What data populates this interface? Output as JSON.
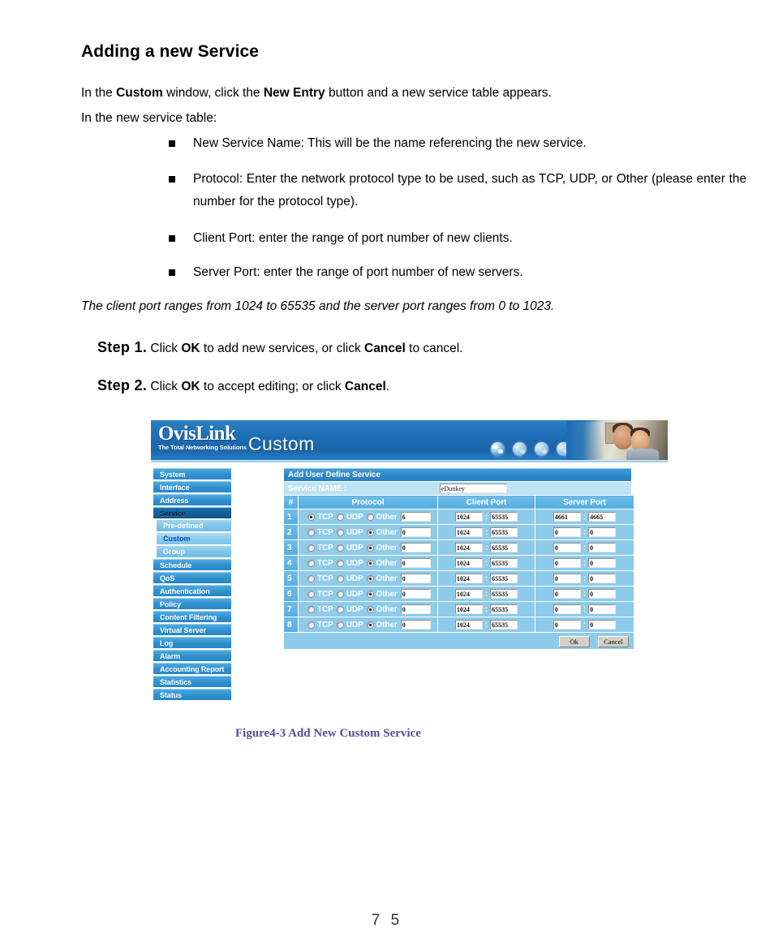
{
  "document": {
    "heading": "Adding a new Service",
    "intro_line_1_parts": [
      "In the ",
      "Custom",
      " window, click the ",
      "New Entry",
      " button and a new service table appears."
    ],
    "intro_line_2": "In the new service table:",
    "bullets": [
      "New Service Name: This will be the name referencing the new service.",
      "Protocol: Enter the network protocol type to be used, such as TCP, UDP, or Other (please enter the number for the protocol type).",
      "Client Port: enter the range of port number of new clients.",
      "Server Port: enter the range of port number of new servers."
    ],
    "note": "The client port ranges from 1024 to 65535 and the server port ranges from 0 to 1023.",
    "steps": [
      {
        "number": "Step 1.",
        "parts": [
          " Click ",
          "OK",
          " to add new services, or click ",
          "Cancel",
          " to cancel."
        ]
      },
      {
        "number": "Step 2.",
        "parts": [
          " Click ",
          "OK",
          " to accept editing; or click ",
          "Cancel",
          "."
        ]
      }
    ],
    "figure_caption": "Figure4-3 Add New Custom Service",
    "page_number": "7 5"
  },
  "screenshot": {
    "brand": {
      "name": "OvisLink",
      "tagline": "The Total Networking Solutions"
    },
    "title": "Custom",
    "sidebar": {
      "items": [
        {
          "label": "System",
          "type": "item",
          "state": "normal"
        },
        {
          "label": "Interface",
          "type": "item",
          "state": "normal"
        },
        {
          "label": "Address",
          "type": "item",
          "state": "normal"
        },
        {
          "label": "Service",
          "type": "item",
          "state": "active"
        },
        {
          "label": "Pre-defined",
          "type": "sub",
          "state": "normal"
        },
        {
          "label": "Custom",
          "type": "sub",
          "state": "selected"
        },
        {
          "label": "Group",
          "type": "sub",
          "state": "normal"
        },
        {
          "label": "Schedule",
          "type": "item",
          "state": "normal"
        },
        {
          "label": "QoS",
          "type": "item",
          "state": "normal"
        },
        {
          "label": "Authentication",
          "type": "item",
          "state": "normal"
        },
        {
          "label": "Policy",
          "type": "item",
          "state": "normal"
        },
        {
          "label": "Content Filtering",
          "type": "item",
          "state": "normal"
        },
        {
          "label": "Virtual Server",
          "type": "item",
          "state": "normal"
        },
        {
          "label": "Log",
          "type": "item",
          "state": "normal"
        },
        {
          "label": "Alarm",
          "type": "item",
          "state": "normal"
        },
        {
          "label": "Accounting Report",
          "type": "item",
          "state": "normal"
        },
        {
          "label": "Statistics",
          "type": "item",
          "state": "normal"
        },
        {
          "label": "Status",
          "type": "item",
          "state": "normal"
        }
      ]
    },
    "panel": {
      "title": "Add User Define Service",
      "service_name_label": "Service NAME :",
      "service_name_value": "eDonkey",
      "columns": [
        "#",
        "Protocol",
        "Client Port",
        "Server Port"
      ],
      "protocol_options": [
        "TCP",
        "UDP",
        "Other"
      ],
      "rows": [
        {
          "num": "1",
          "selected": "TCP",
          "other": "6",
          "client_from": "1024",
          "client_to": "65535",
          "server_from": "4661",
          "server_to": "4665"
        },
        {
          "num": "2",
          "selected": "Other",
          "other": "0",
          "client_from": "1024",
          "client_to": "65535",
          "server_from": "0",
          "server_to": "0"
        },
        {
          "num": "3",
          "selected": "Other",
          "other": "0",
          "client_from": "1024",
          "client_to": "65535",
          "server_from": "0",
          "server_to": "0"
        },
        {
          "num": "4",
          "selected": "Other",
          "other": "0",
          "client_from": "1024",
          "client_to": "65535",
          "server_from": "0",
          "server_to": "0"
        },
        {
          "num": "5",
          "selected": "Other",
          "other": "0",
          "client_from": "1024",
          "client_to": "65535",
          "server_from": "0",
          "server_to": "0"
        },
        {
          "num": "6",
          "selected": "Other",
          "other": "0",
          "client_from": "1024",
          "client_to": "65535",
          "server_from": "0",
          "server_to": "0"
        },
        {
          "num": "7",
          "selected": "Other",
          "other": "0",
          "client_from": "1024",
          "client_to": "65535",
          "server_from": "0",
          "server_to": "0"
        },
        {
          "num": "8",
          "selected": "Other",
          "other": "0",
          "client_from": "1024",
          "client_to": "65535",
          "server_from": "0",
          "server_to": "0"
        }
      ],
      "separator": ":",
      "ok_label": "Ok",
      "cancel_label": "Cancel"
    },
    "colors": {
      "header_blue": "#1d6cb4",
      "nav_blue": "#2e8fcd",
      "nav_active": "#135c96",
      "table_blue": "#8ecbea",
      "caption_purple": "#5b4a9c"
    }
  }
}
